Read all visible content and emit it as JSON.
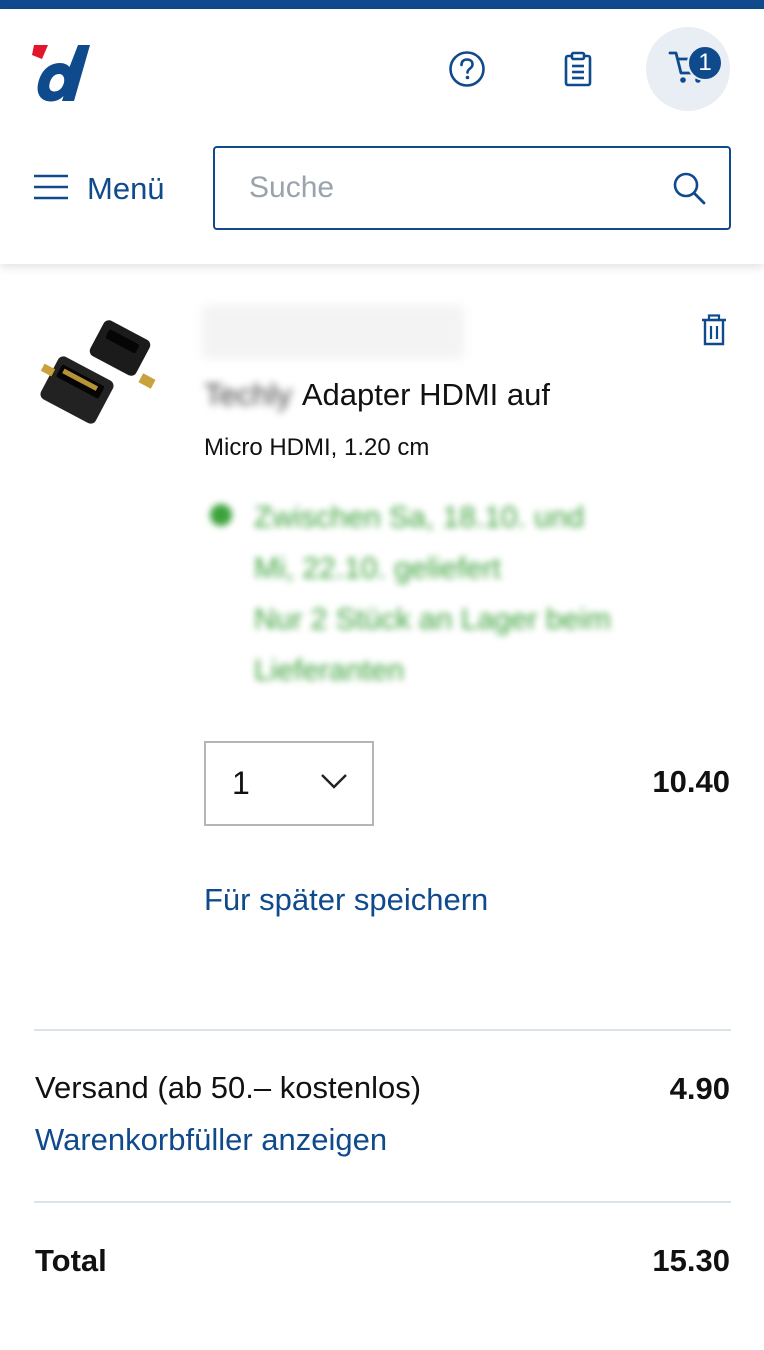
{
  "header": {
    "cart_count": "1",
    "menu_label": "Menü",
    "search_placeholder": "Suche"
  },
  "cart_item": {
    "brand": "Techly",
    "title_line1": "Adapter HDMI auf",
    "title_line2": "Micro HDMI, 1.20 cm",
    "availability": [
      "Zwischen Sa, 18.10. und",
      "Mi, 22.10. geliefert",
      "Nur 2 Stück an Lager beim",
      "Lieferanten"
    ],
    "quantity": "1",
    "price": "10.40",
    "save_later_label": "Für später speichern"
  },
  "summary": {
    "shipping_label": "Versand (ab 50.– kostenlos)",
    "shipping_price": "4.90",
    "filler_link": "Warenkorbfüller anzeigen",
    "total_label": "Total",
    "total_price": "15.30"
  },
  "colors": {
    "brand_blue": "#0f4a8c",
    "logo_red": "#e3162b",
    "availability_green": "#3ca23c"
  }
}
